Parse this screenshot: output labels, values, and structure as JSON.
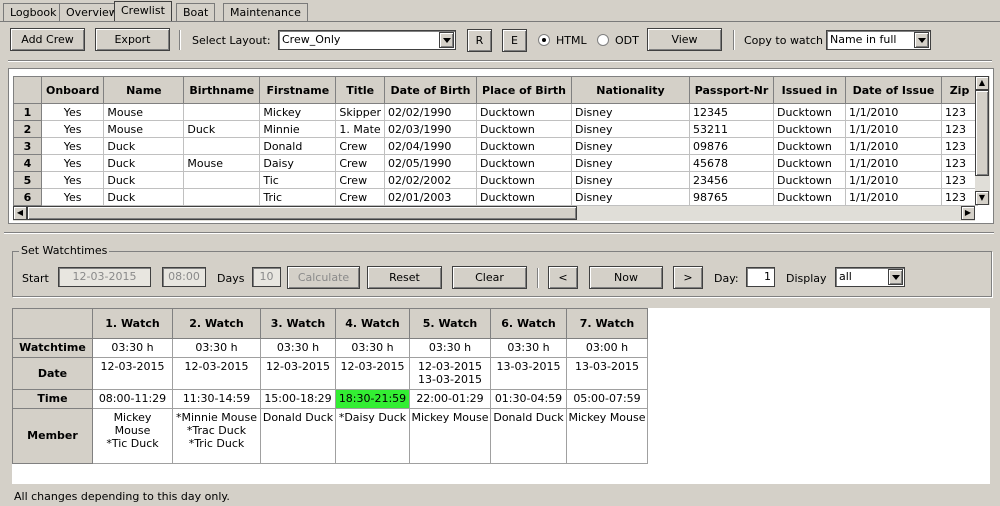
{
  "tabs": [
    "Logbook",
    "Overview",
    "Crewlist",
    "Boat",
    "Maintenance"
  ],
  "toolbar": {
    "add_crew": "Add Crew",
    "export": "Export",
    "select_layout_label": "Select Layout:",
    "layout_value": "Crew_Only",
    "r_button": "R",
    "e_button": "E",
    "html_label": "HTML",
    "odt_label": "ODT",
    "format_selected": "HTML",
    "view": "View",
    "copy_to_watch_label": "Copy to watch",
    "copy_to_watch_value": "Name in full"
  },
  "crew": {
    "columns": [
      "Onboard",
      "Name",
      "Birthname",
      "Firstname",
      "Title",
      "Date of Birth",
      "Place of Birth",
      "Nationality",
      "Passport-Nr",
      "Issued in",
      "Date of Issue",
      "Zip"
    ],
    "rows": [
      {
        "num": "1",
        "cells": [
          "Yes",
          "Mouse",
          "",
          "Mickey",
          "Skipper",
          "02/02/1990",
          "Ducktown",
          "Disney",
          "12345",
          "Ducktown",
          "1/1/2010",
          "123"
        ]
      },
      {
        "num": "2",
        "cells": [
          "Yes",
          "Mouse",
          "Duck",
          "Minnie",
          "1. Mate",
          "02/03/1990",
          "Ducktown",
          "Disney",
          "53211",
          "Ducktown",
          "1/1/2010",
          "123"
        ]
      },
      {
        "num": "3",
        "cells": [
          "Yes",
          "Duck",
          "",
          "Donald",
          "Crew",
          "02/04/1990",
          "Ducktown",
          "Disney",
          "09876",
          "Ducktown",
          "1/1/2010",
          "123"
        ]
      },
      {
        "num": "4",
        "cells": [
          "Yes",
          "Duck",
          "Mouse",
          "Daisy",
          "Crew",
          "02/05/1990",
          "Ducktown",
          "Disney",
          "45678",
          "Ducktown",
          "1/1/2010",
          "123"
        ]
      },
      {
        "num": "5",
        "cells": [
          "Yes",
          "Duck",
          "",
          "Tic",
          "Crew",
          "02/02/2002",
          "Ducktown",
          "Disney",
          "23456",
          "Ducktown",
          "1/1/2010",
          "123"
        ]
      },
      {
        "num": "6",
        "cells": [
          "Yes",
          "Duck",
          "",
          "Tric",
          "Crew",
          "02/01/2003",
          "Ducktown",
          "Disney",
          "98765",
          "Ducktown",
          "1/1/2010",
          "123"
        ]
      }
    ]
  },
  "watchtimes": {
    "group_title": "Set Watchtimes",
    "start_label": "Start",
    "start_date": "12-03-2015",
    "start_time": "08:00",
    "days_label": "Days",
    "days_value": "10",
    "calculate": "Calculate",
    "reset": "Reset",
    "clear": "Clear",
    "prev": "<",
    "now": "Now",
    "next": ">",
    "day_label": "Day:",
    "day_value": "1",
    "display_label": "Display",
    "display_value": "all"
  },
  "watches": {
    "row_headers": [
      "Watchtime",
      "Date",
      "Time",
      "Member"
    ],
    "columns": [
      {
        "title": "1. Watch",
        "watchtime": "03:30 h",
        "date": [
          "12-03-2015"
        ],
        "time": "08:00-11:29",
        "members": [
          "Mickey Mouse",
          "*Tic Duck"
        ],
        "current": false
      },
      {
        "title": "2. Watch",
        "watchtime": "03:30 h",
        "date": [
          "12-03-2015"
        ],
        "time": "11:30-14:59",
        "members": [
          "*Minnie Mouse",
          "*Trac Duck",
          "*Tric Duck"
        ],
        "current": false
      },
      {
        "title": "3. Watch",
        "watchtime": "03:30 h",
        "date": [
          "12-03-2015"
        ],
        "time": "15:00-18:29",
        "members": [
          "Donald Duck"
        ],
        "current": false
      },
      {
        "title": "4. Watch",
        "watchtime": "03:30 h",
        "date": [
          "12-03-2015"
        ],
        "time": "18:30-21:59",
        "members": [
          "*Daisy Duck"
        ],
        "current": true
      },
      {
        "title": "5. Watch",
        "watchtime": "03:30 h",
        "date": [
          "12-03-2015",
          "13-03-2015"
        ],
        "time": "22:00-01:29",
        "members": [
          "Mickey Mouse"
        ],
        "current": false
      },
      {
        "title": "6. Watch",
        "watchtime": "03:30 h",
        "date": [
          "13-03-2015"
        ],
        "time": "01:30-04:59",
        "members": [
          "Donald Duck"
        ],
        "current": false
      },
      {
        "title": "7. Watch",
        "watchtime": "03:00 h",
        "date": [
          "13-03-2015"
        ],
        "time": "05:00-07:59",
        "members": [
          "Mickey Mouse"
        ],
        "current": false
      }
    ],
    "highlight_color": "#33ee33"
  },
  "status": "All changes depending to this day only."
}
